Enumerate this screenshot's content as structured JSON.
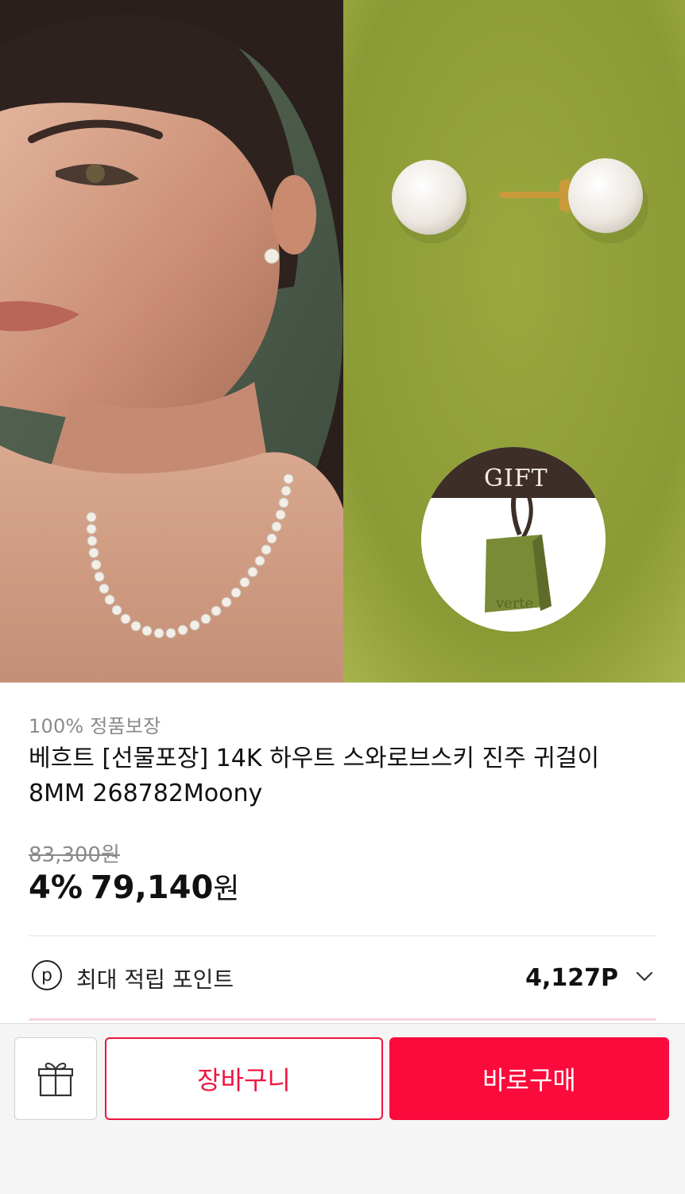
{
  "hero": {
    "gift_label": "GIFT",
    "bag_brand": "verte",
    "colors": {
      "green_bg": "#8f9e37",
      "bag": "#788b37",
      "gift_top": "#3e2e28"
    }
  },
  "product": {
    "guarantee": "100% 정품보장",
    "title": "베흐트 [선물포장] 14K 하우트 스와로브스키 진주 귀걸이 8MM 268782Moony",
    "original_price": "83,300원",
    "discount": "4%",
    "price": "79,140",
    "currency": "원"
  },
  "points": {
    "icon_letter": "p",
    "label": "최대 적립 포인트",
    "value": "4,127P"
  },
  "actions": {
    "gift_icon": "gift-icon",
    "cart_label": "장바구니",
    "buy_label": "바로구매",
    "accent": "#fb0a3c"
  }
}
